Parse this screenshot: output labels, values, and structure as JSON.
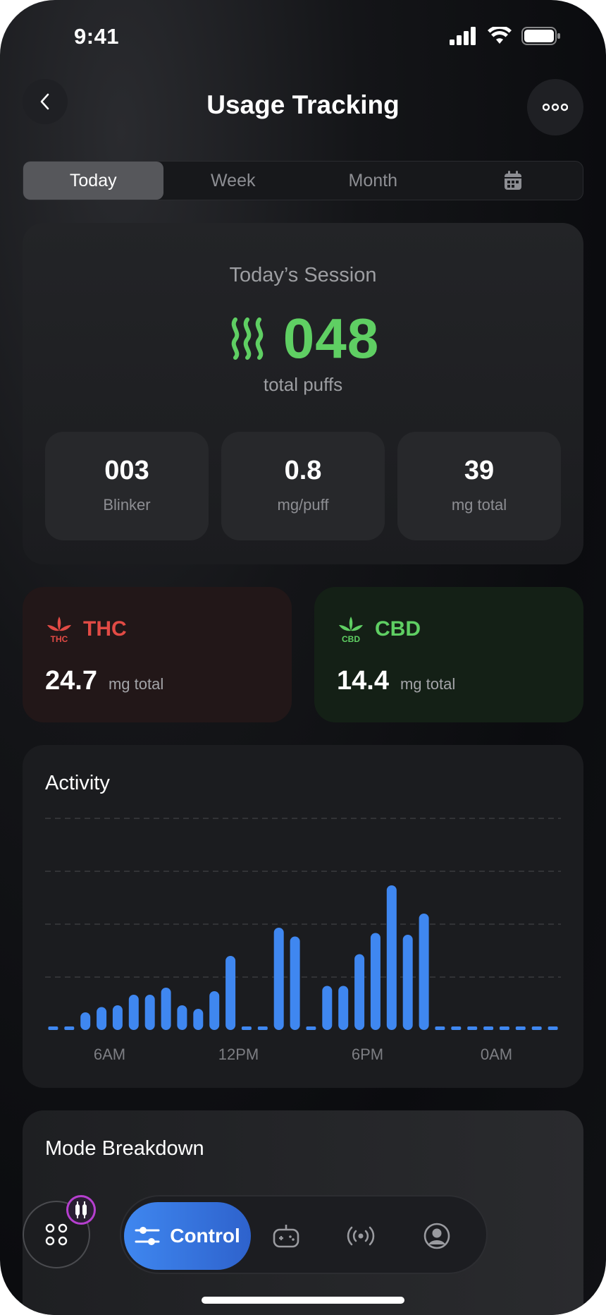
{
  "status_bar": {
    "time": "9:41"
  },
  "header": {
    "title": "Usage Tracking",
    "back_icon": "chevron-left-icon",
    "more_icon": "more-horizontal-icon"
  },
  "range_tabs": [
    {
      "label": "Today",
      "active": true
    },
    {
      "label": "Week",
      "active": false
    },
    {
      "label": "Month",
      "active": false
    },
    {
      "label": "",
      "icon": "calendar-icon",
      "active": false
    }
  ],
  "session": {
    "label": "Today’s Session",
    "value": "048",
    "unit": "total puffs",
    "stats": [
      {
        "value": "003",
        "label": "Blinker"
      },
      {
        "value": "0.8",
        "label": "mg/puff"
      },
      {
        "value": "39",
        "label": "mg total"
      }
    ]
  },
  "cannabinoids": {
    "thc": {
      "title": "THC",
      "icon_text": "THC",
      "value": "24.7",
      "unit": "mg total",
      "color": "#e24b45"
    },
    "cbd": {
      "title": "CBD",
      "icon_text": "CBD",
      "value": "14.4",
      "unit": "mg total",
      "color": "#5fcf63"
    }
  },
  "activity": {
    "title": "Activity"
  },
  "chart_data": {
    "type": "bar",
    "title": "Activity",
    "x_tick_labels": [
      "6AM",
      "12PM",
      "6PM",
      "0AM"
    ],
    "values": [
      0.2,
      0.2,
      1.0,
      1.3,
      1.4,
      2.0,
      2.0,
      2.4,
      1.4,
      1.2,
      2.2,
      4.2,
      0.2,
      0.2,
      5.8,
      5.3,
      0.2,
      2.5,
      2.5,
      4.3,
      5.5,
      8.2,
      5.4,
      6.6,
      0.2,
      0.2,
      0.2,
      0.2,
      0.2,
      0.2,
      0.2,
      0.2
    ],
    "ylim": [
      0,
      12
    ],
    "grid": true,
    "color": "#3f87f0"
  },
  "mode_breakdown": {
    "title": "Mode Breakdown"
  },
  "bottom_nav": {
    "control_label": "Control",
    "items": [
      "gamepad-icon",
      "broadcast-icon",
      "profile-icon"
    ]
  },
  "colors": {
    "accent": "#3f87f0",
    "green": "#5fcf63",
    "red": "#e24b45"
  }
}
